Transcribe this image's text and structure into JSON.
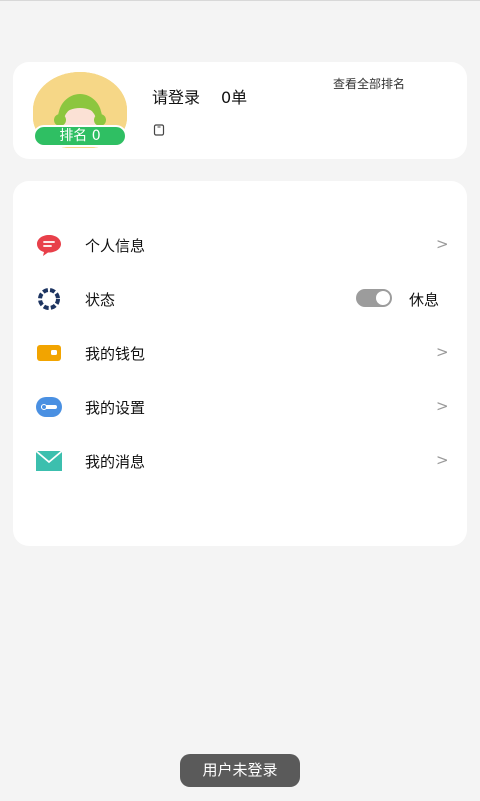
{
  "profile": {
    "rank_badge": "排名 0",
    "title": "请登录",
    "order_count": "0单",
    "view_all_rank": "查看全部排名"
  },
  "menu": {
    "items": [
      {
        "label": "个人信息",
        "icon": "chat-bubble-icon",
        "chevron": ">"
      },
      {
        "label": "状态",
        "icon": "status-ring-icon",
        "status_value": "休息",
        "toggle_on": true
      },
      {
        "label": "我的钱包",
        "icon": "wallet-icon",
        "chevron": ">"
      },
      {
        "label": "我的设置",
        "icon": "settings-toggle-icon",
        "chevron": ">"
      },
      {
        "label": "我的消息",
        "icon": "envelope-icon",
        "chevron": ">"
      }
    ]
  },
  "toast": {
    "text": "用户未登录"
  },
  "colors": {
    "rank_badge": "#2fbf63",
    "avatar_bg": "#f6d787",
    "chat_icon": "#e8404a",
    "status_icon": "#1d3461",
    "wallet_icon": "#f2a400",
    "settings_icon": "#4a90e2",
    "mail_icon": "#3cbfae"
  }
}
